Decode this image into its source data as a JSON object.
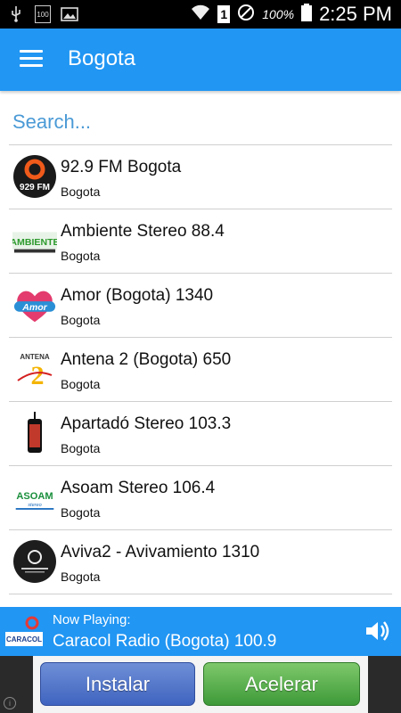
{
  "status_bar": {
    "badge_text": "100",
    "battery_percent": "100%",
    "time": "2:25 PM",
    "sim_number": "1"
  },
  "app_bar": {
    "title": "Bogota"
  },
  "search": {
    "placeholder": "Search..."
  },
  "stations": [
    {
      "name": "92.9 FM Bogota",
      "city": "Bogota",
      "logo_text": "929 FM"
    },
    {
      "name": "Ambiente Stereo 88.4",
      "city": "Bogota",
      "logo_text": "AMBIENTE"
    },
    {
      "name": "Amor (Bogota) 1340",
      "city": "Bogota",
      "logo_text": "Amor"
    },
    {
      "name": "Antena 2 (Bogota) 650",
      "city": "Bogota",
      "logo_text": "ANTENA 2"
    },
    {
      "name": "Apartadó Stereo 103.3",
      "city": "Bogota"
    },
    {
      "name": "Asoam Stereo 106.4",
      "city": "Bogota",
      "logo_text": "ASOAM"
    },
    {
      "name": "Aviva2 - Avivamiento 1310",
      "city": "Bogota"
    }
  ],
  "player": {
    "label": "Now Playing:",
    "station": "Caracol Radio (Bogota) 100.9",
    "logo_text": "CARACOL"
  },
  "ad": {
    "install_label": "Instalar",
    "accelerate_label": "Acelerar",
    "info_symbol": "i"
  },
  "colors": {
    "primary": "#2196f3",
    "search_text": "#4a9ad6",
    "install_button": "#4f72c8",
    "accelerate_button": "#55b04a"
  }
}
